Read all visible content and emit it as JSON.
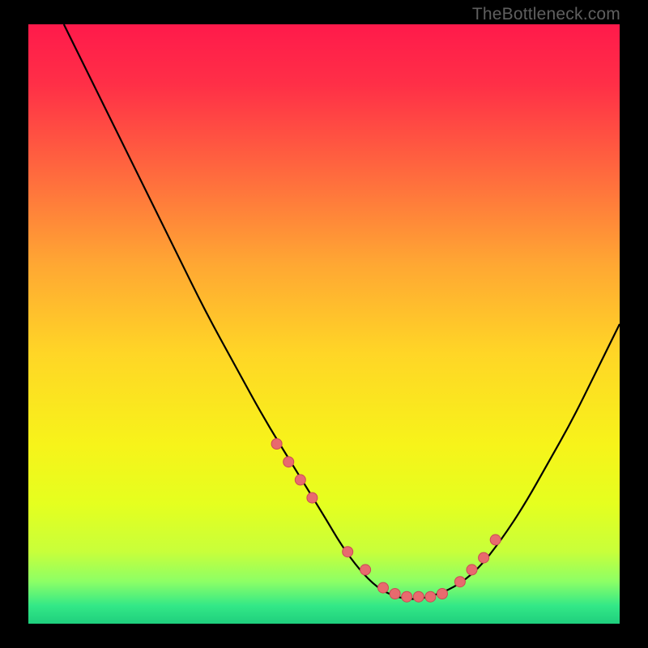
{
  "watermark": "TheBottleneck.com",
  "colors": {
    "black": "#000000",
    "curve": "#000000",
    "dot_fill": "#e86a6e",
    "dot_stroke": "#cc4a55"
  },
  "chart_data": {
    "type": "line",
    "title": "",
    "xlabel": "",
    "ylabel": "",
    "xlim": [
      0,
      100
    ],
    "ylim": [
      0,
      100
    ],
    "gradient_stops": [
      {
        "pos": 0.0,
        "color": "#ff1a4b"
      },
      {
        "pos": 0.1,
        "color": "#ff2f47"
      },
      {
        "pos": 0.25,
        "color": "#ff6a3e"
      },
      {
        "pos": 0.4,
        "color": "#ffa733"
      },
      {
        "pos": 0.55,
        "color": "#ffd626"
      },
      {
        "pos": 0.7,
        "color": "#f7f31a"
      },
      {
        "pos": 0.8,
        "color": "#e5ff1f"
      },
      {
        "pos": 0.88,
        "color": "#c8ff3a"
      },
      {
        "pos": 0.93,
        "color": "#8cff66"
      },
      {
        "pos": 0.97,
        "color": "#33e887"
      },
      {
        "pos": 1.0,
        "color": "#1fcf7d"
      }
    ],
    "series": [
      {
        "name": "bottleneck-curve",
        "x": [
          6,
          10,
          15,
          20,
          25,
          30,
          35,
          40,
          45,
          50,
          53,
          56,
          59,
          62,
          65,
          68,
          72,
          76,
          80,
          84,
          88,
          92,
          96,
          100
        ],
        "y": [
          100,
          92,
          82,
          72,
          62,
          52,
          43,
          34,
          26,
          18,
          13,
          9,
          6,
          4.5,
          4,
          4.5,
          6,
          9,
          14,
          20,
          27,
          34,
          42,
          50
        ]
      }
    ],
    "dots": {
      "name": "highlight-dots",
      "x": [
        42,
        44,
        46,
        48,
        54,
        57,
        60,
        62,
        64,
        66,
        68,
        70,
        73,
        75,
        77,
        79
      ],
      "y": [
        30,
        27,
        24,
        21,
        12,
        9,
        6,
        5,
        4.5,
        4.5,
        4.5,
        5,
        7,
        9,
        11,
        14
      ]
    }
  }
}
